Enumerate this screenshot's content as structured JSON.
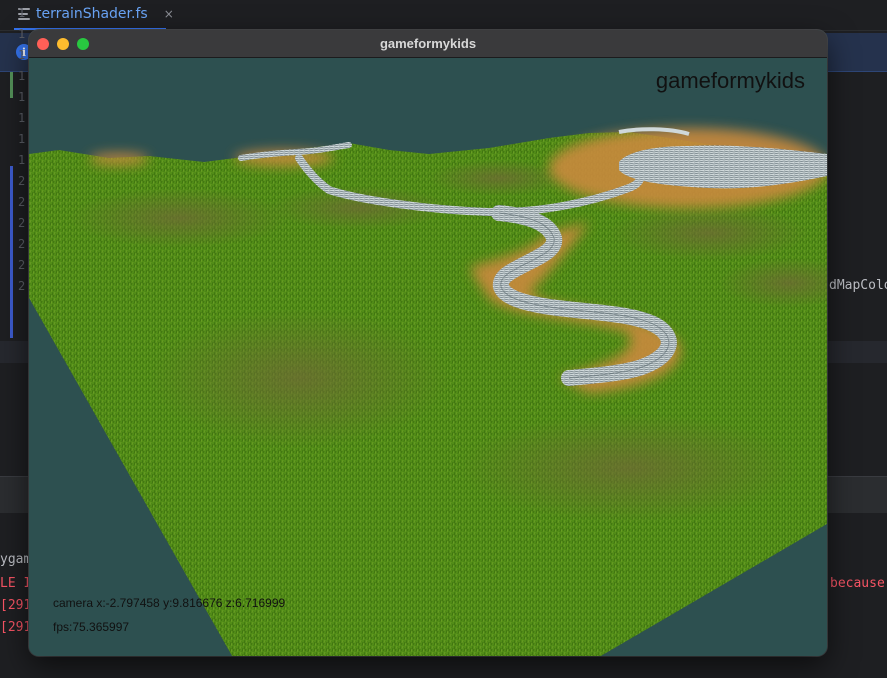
{
  "ide": {
    "tab_label": "terrainShader.fs",
    "tab_close": "×",
    "info_icon": "i",
    "gutter_digits": [
      "1",
      "1",
      "1",
      "1",
      "1",
      "1",
      "1",
      "1",
      "2",
      "2",
      "2",
      "2",
      "2",
      "2"
    ],
    "code_fragment": "dMapColo",
    "console": {
      "line1": "ygam",
      "line2": "LE I",
      "line2_right": "because",
      "line3": "[291",
      "line4": "[291"
    }
  },
  "window": {
    "title": "gameformykids"
  },
  "game": {
    "overlay_title": "gameformykids",
    "camera_text": "camera x:-2.797458 y:9.816676 z:6.716999",
    "fps_text": "fps:75.365997",
    "colors": {
      "sky": "#2d5050",
      "grass": "#4f8a16",
      "dirt": "#c98a3c",
      "rock": "#c9d3d6"
    }
  }
}
